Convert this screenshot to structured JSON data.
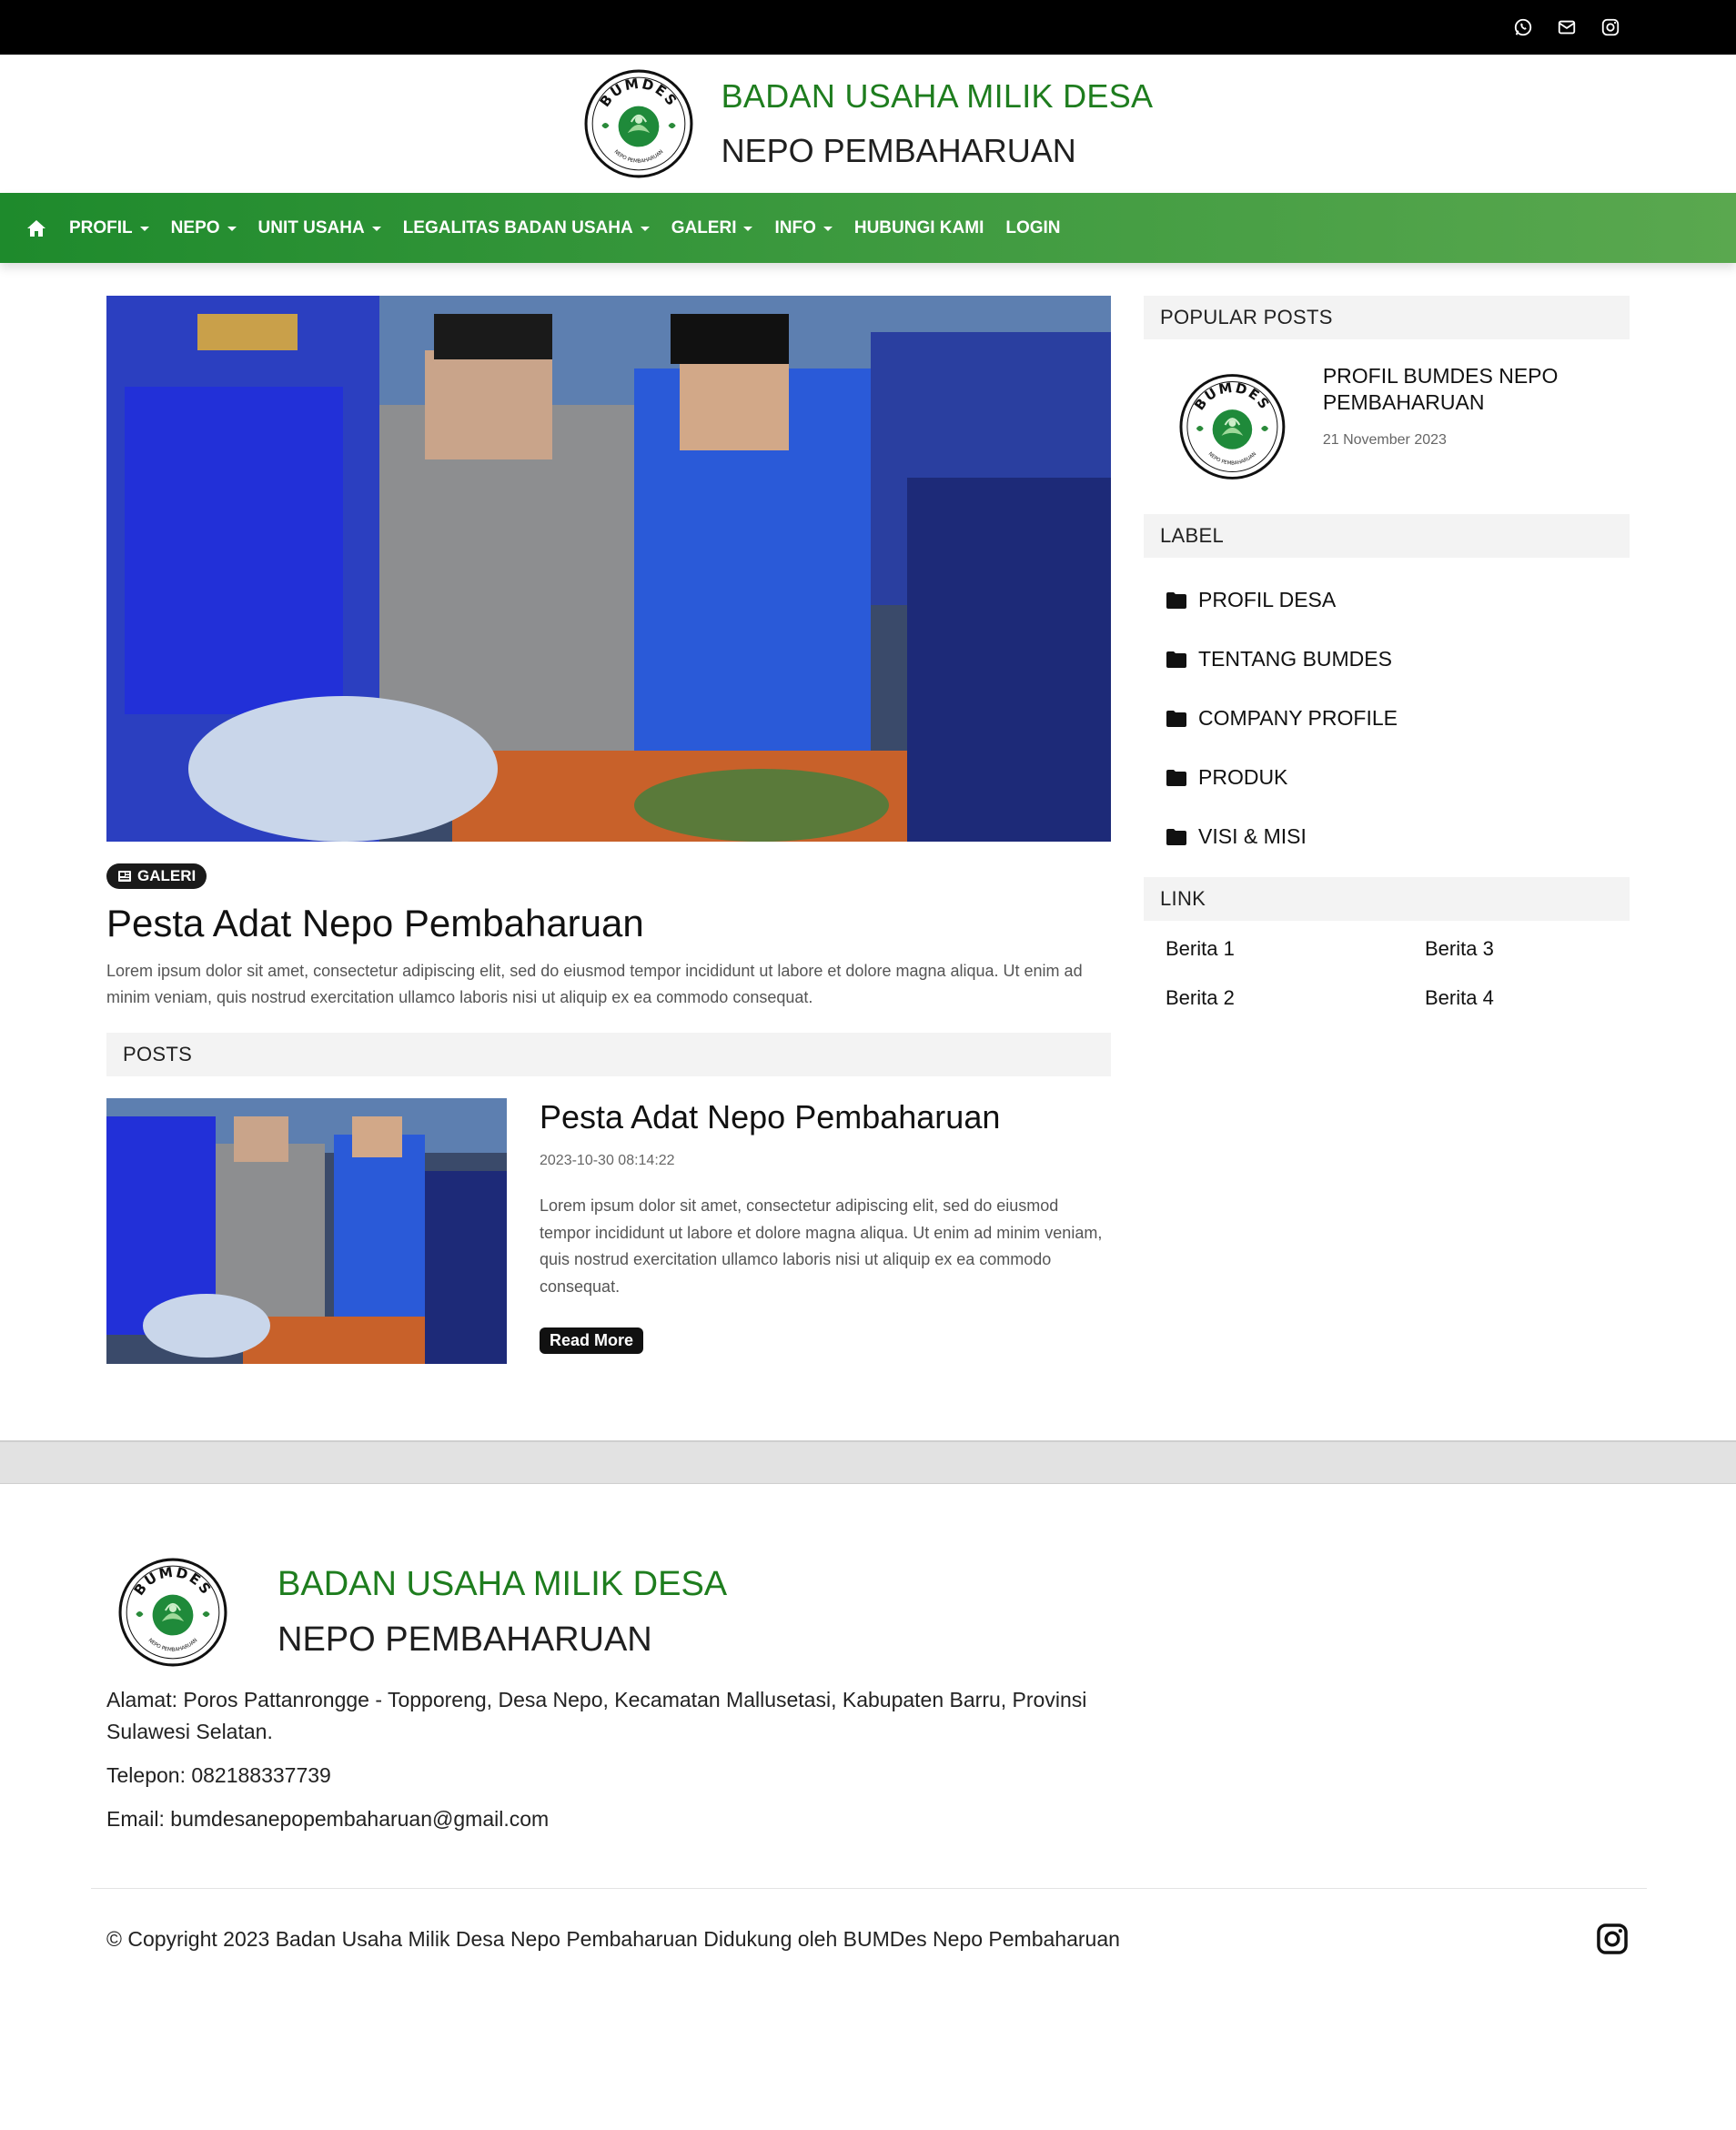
{
  "topbar": {
    "icons": [
      "whatsapp-icon",
      "envelope-icon",
      "instagram-icon"
    ]
  },
  "header": {
    "line1": "BADAN USAHA MILIK DESA",
    "line2": "NEPO PEMBAHARUAN",
    "logo_text": "BUMDES",
    "logo_subtext": "NEPO PEMBAHARUAN"
  },
  "nav": {
    "items": [
      {
        "label": "PROFIL",
        "dropdown": true
      },
      {
        "label": "NEPO",
        "dropdown": true
      },
      {
        "label": "UNIT USAHA",
        "dropdown": true
      },
      {
        "label": "LEGALITAS BADAN USAHA",
        "dropdown": true
      },
      {
        "label": "GALERI",
        "dropdown": true
      },
      {
        "label": "INFO",
        "dropdown": true
      },
      {
        "label": "HUBUNGI KAMI",
        "dropdown": false
      },
      {
        "label": "LOGIN",
        "dropdown": false
      }
    ]
  },
  "hero": {
    "badge": "GALERI",
    "title": "Pesta Adat Nepo Pembaharuan",
    "text": "Lorem ipsum dolor sit amet, consectetur adipiscing elit, sed do eiusmod tempor incididunt ut labore et dolore magna aliqua. Ut enim ad minim veniam, quis nostrud exercitation ullamco laboris nisi ut aliquip ex ea commodo consequat."
  },
  "posts": {
    "heading": "POSTS",
    "items": [
      {
        "title": "Pesta Adat Nepo Pembaharuan",
        "date": "2023-10-30 08:14:22",
        "text": "Lorem ipsum dolor sit amet, consectetur adipiscing elit, sed do eiusmod tempor incididunt ut labore et dolore magna aliqua. Ut enim ad minim veniam, quis nostrud exercitation ullamco laboris nisi ut aliquip ex ea commodo consequat.",
        "read_more": "Read More"
      }
    ]
  },
  "sidebar": {
    "popular_heading": "POPULAR POSTS",
    "popular": {
      "title": "PROFIL BUMDES NEPO PEMBAHARUAN",
      "date": "21 November 2023"
    },
    "label_heading": "LABEL",
    "labels": [
      "PROFIL DESA",
      "TENTANG BUMDES",
      "COMPANY PROFILE",
      "PRODUK",
      "VISI & MISI"
    ],
    "link_heading": "LINK",
    "links": [
      "Berita 1",
      "Berita 3",
      "Berita 2",
      "Berita 4"
    ]
  },
  "footer": {
    "line1": "BADAN USAHA MILIK DESA",
    "line2": "NEPO PEMBAHARUAN",
    "address": "Alamat: Poros Pattanrongge - Topporeng, Desa Nepo, Kecamatan Mallusetasi, Kabupaten Barru, Provinsi Sulawesi Selatan.",
    "phone": "Telepon: 082188337739",
    "email": "Email: bumdesanepopembaharuan@gmail.com",
    "copyright": "© Copyright 2023 Badan Usaha Milik Desa Nepo Pembaharuan Didukung oleh BUMDes Nepo Pembaharuan"
  },
  "colors": {
    "brand_green": "#1e7d1e",
    "nav_start": "#1e8a2c",
    "nav_end": "#5aa84f"
  }
}
